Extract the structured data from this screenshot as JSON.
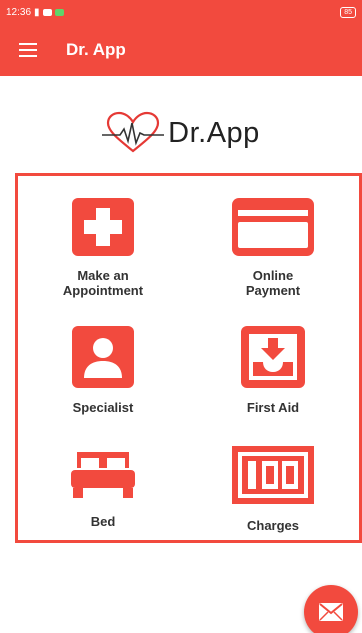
{
  "status_bar": {
    "time": "12:36",
    "battery": "85"
  },
  "app_bar": {
    "title": "Dr. App"
  },
  "logo": {
    "text": "Dr.App"
  },
  "tiles": [
    {
      "label": "Make an\nAppointment",
      "icon": "medical-cross-icon"
    },
    {
      "label": "Online\nPayment",
      "icon": "credit-card-icon"
    },
    {
      "label": "Specialist",
      "icon": "person-icon"
    },
    {
      "label": "First Aid",
      "icon": "download-tray-icon"
    },
    {
      "label": "Bed",
      "icon": "bed-icon"
    },
    {
      "label": "Charges",
      "icon": "counter-100-icon"
    }
  ],
  "fab": {
    "icon": "mail-icon"
  },
  "colors": {
    "accent": "#f24a3e",
    "text": "#333333"
  }
}
